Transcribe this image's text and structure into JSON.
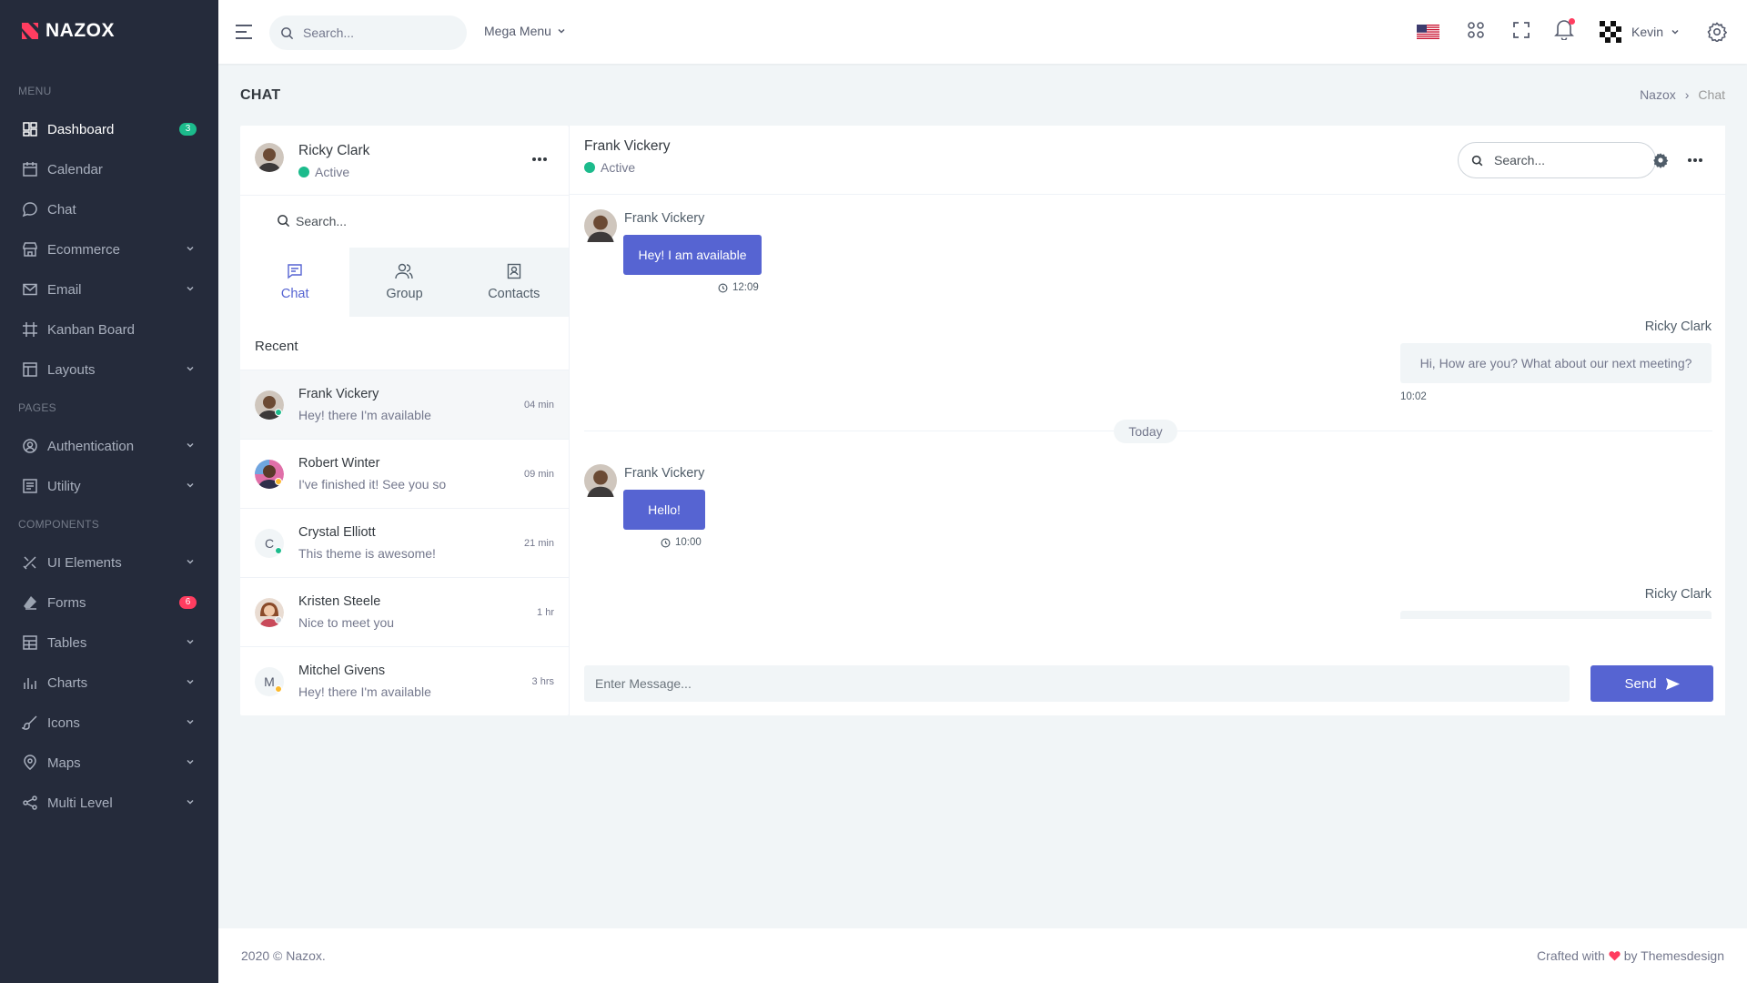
{
  "brand": {
    "name": "NAZOX",
    "color": "#ff3d60"
  },
  "sidebar": {
    "section_menu": "MENU",
    "section_pages": "PAGES",
    "section_components": "COMPONENTS",
    "items": [
      {
        "label": "Dashboard",
        "icon": "dashboard-icon",
        "badge": "3"
      },
      {
        "label": "Calendar",
        "icon": "calendar-icon"
      },
      {
        "label": "Chat",
        "icon": "chat-icon"
      },
      {
        "label": "Ecommerce",
        "icon": "store-icon"
      },
      {
        "label": "Email",
        "icon": "mail-icon"
      },
      {
        "label": "Kanban Board",
        "icon": "kanban-icon"
      },
      {
        "label": "Layouts",
        "icon": "layout-icon"
      },
      {
        "label": "Authentication",
        "icon": "account-icon"
      },
      {
        "label": "Utility",
        "icon": "utility-icon"
      },
      {
        "label": "UI Elements",
        "icon": "pencil-ruler-icon"
      },
      {
        "label": "Forms",
        "icon": "eraser-icon",
        "badge": "6"
      },
      {
        "label": "Tables",
        "icon": "table-icon"
      },
      {
        "label": "Charts",
        "icon": "bar-chart-icon"
      },
      {
        "label": "Icons",
        "icon": "brush-icon"
      },
      {
        "label": "Maps",
        "icon": "map-pin-icon"
      },
      {
        "label": "Multi Level",
        "icon": "share-icon"
      }
    ],
    "badge_green": "#1cbb8c",
    "badge_red": "#ff3d60"
  },
  "topbar": {
    "search_placeholder": "Search...",
    "mega_menu": "Mega Menu",
    "user_name": "Kevin"
  },
  "page": {
    "title": "CHAT",
    "breadcrumb": [
      "Nazox",
      "Chat"
    ]
  },
  "left_panel": {
    "profile": {
      "name": "Ricky Clark",
      "status": "Active"
    },
    "search_placeholder": "Search...",
    "tabs": [
      {
        "label": "Chat",
        "icon": "chat-bubble-icon"
      },
      {
        "label": "Group",
        "icon": "group-icon"
      },
      {
        "label": "Contacts",
        "icon": "contacts-icon"
      }
    ],
    "recent_label": "Recent",
    "contacts": [
      {
        "name": "Frank Vickery",
        "message": "Hey! there I'm available",
        "time": "04 min",
        "status_color": "#1cbb8c"
      },
      {
        "name": "Robert Winter",
        "message": "I've finished it! See you so",
        "time": "09 min",
        "status_color": "#fcb92c"
      },
      {
        "name": "Crystal Elliott",
        "message": "This theme is awesome!",
        "time": "21 min",
        "initial": "C",
        "status_color": "#1cbb8c"
      },
      {
        "name": "Kristen Steele",
        "message": "Nice to meet you",
        "time": "1 hr",
        "status_color": "#ced4da"
      },
      {
        "name": "Mitchel Givens",
        "message": "Hey! there I'm available",
        "time": "3 hrs",
        "initial": "M",
        "status_color": "#fcb92c"
      }
    ]
  },
  "conversation": {
    "header_name": "Frank Vickery",
    "header_status": "Active",
    "search_placeholder": "Search...",
    "messages": [
      {
        "sender": "Frank Vickery",
        "text": "Hey! I am available",
        "time": "12:09"
      },
      {
        "sender": "Ricky Clark",
        "text": "Hi, How are you? What about our next meeting?",
        "time": "10:02"
      },
      {
        "sender": "Frank Vickery",
        "text": "Hello!",
        "time": "10:00"
      },
      {
        "sender": "Ricky Clark",
        "text": "",
        "time": ""
      }
    ],
    "divider": "Today",
    "composer_placeholder": "Enter Message...",
    "send_label": "Send",
    "accent": "#5664d2"
  },
  "footer": {
    "left": "2020 © Nazox.",
    "right_prefix": "Crafted with",
    "right_suffix": "by Themesdesign"
  }
}
